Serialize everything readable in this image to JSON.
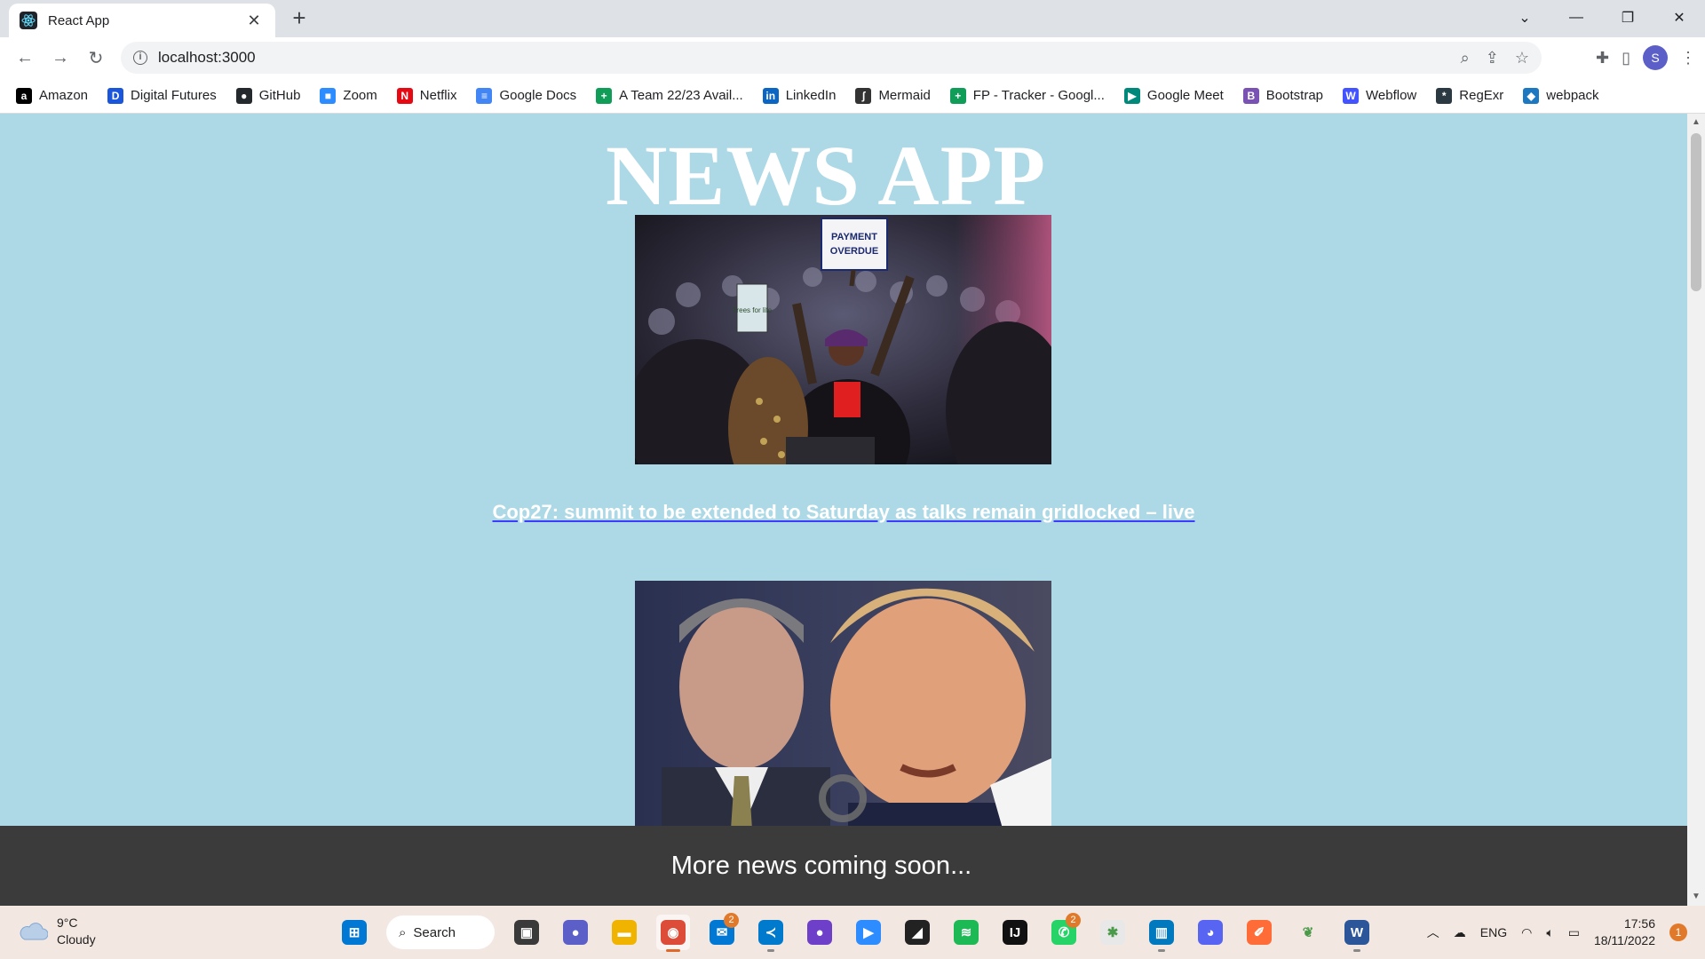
{
  "browser": {
    "tab_title": "React App",
    "url": "localhost:3000",
    "profile_initial": "S"
  },
  "bookmarks": [
    {
      "label": "Amazon",
      "icon": "amazon-icon",
      "color": "#000000",
      "glyph": "a"
    },
    {
      "label": "Digital Futures",
      "icon": "digital-futures-icon",
      "color": "#1a56db",
      "glyph": "D"
    },
    {
      "label": "GitHub",
      "icon": "github-icon",
      "color": "#24292e",
      "glyph": "●"
    },
    {
      "label": "Zoom",
      "icon": "zoom-icon",
      "color": "#2d8cff",
      "glyph": "■"
    },
    {
      "label": "Netflix",
      "icon": "netflix-icon",
      "color": "#e50914",
      "glyph": "N"
    },
    {
      "label": "Google Docs",
      "icon": "google-docs-icon",
      "color": "#4285f4",
      "glyph": "≡"
    },
    {
      "label": "A Team 22/23 Avail...",
      "icon": "google-sheets-icon",
      "color": "#0f9d58",
      "glyph": "+"
    },
    {
      "label": "LinkedIn",
      "icon": "linkedin-icon",
      "color": "#0a66c2",
      "glyph": "in"
    },
    {
      "label": "Mermaid",
      "icon": "mermaid-icon",
      "color": "#333333",
      "glyph": "ʃ"
    },
    {
      "label": "FP - Tracker - Googl...",
      "icon": "google-sheets-icon",
      "color": "#0f9d58",
      "glyph": "+"
    },
    {
      "label": "Google Meet",
      "icon": "google-meet-icon",
      "color": "#00897b",
      "glyph": "▶"
    },
    {
      "label": "Bootstrap",
      "icon": "bootstrap-icon",
      "color": "#7952b3",
      "glyph": "B"
    },
    {
      "label": "Webflow",
      "icon": "webflow-icon",
      "color": "#4353ff",
      "glyph": "W"
    },
    {
      "label": "RegExr",
      "icon": "regexr-icon",
      "color": "#2b3a42",
      "glyph": "*"
    },
    {
      "label": "webpack",
      "icon": "webpack-icon",
      "color": "#1c78c0",
      "glyph": "◆"
    }
  ],
  "app": {
    "title": "NEWS APP",
    "articles": [
      {
        "headline": "Cop27: summit to be extended to Saturday as talks remain gridlocked – live",
        "image_alt": "Protesters at COP27 holding a PAYMENT OVERDUE sign",
        "sign_text": "PAYMENT OVERDUE",
        "sign_sub": "Trees for life"
      },
      {
        "headline": "",
        "image_alt": "Two men at a press briefing"
      }
    ],
    "footer": "More news coming soon..."
  },
  "taskbar": {
    "weather_temp": "9°C",
    "weather_desc": "Cloudy",
    "search_label": "Search",
    "apps": [
      {
        "name": "windows-start",
        "color": "#0078d4",
        "glyph": "⊞"
      },
      {
        "name": "task-view",
        "color": "#3a3a3a",
        "glyph": "▣"
      },
      {
        "name": "teams-chat",
        "color": "#5b5fc7",
        "glyph": "●"
      },
      {
        "name": "file-explorer",
        "color": "#f0b400",
        "glyph": "▬"
      },
      {
        "name": "chrome",
        "color": "#dd4b39",
        "glyph": "◉",
        "active": true
      },
      {
        "name": "mail",
        "color": "#0078d4",
        "glyph": "✉",
        "badge": "2"
      },
      {
        "name": "vs-code",
        "color": "#007acc",
        "glyph": "≺"
      },
      {
        "name": "github-desktop",
        "color": "#6e40c9",
        "glyph": "●"
      },
      {
        "name": "zoom",
        "color": "#2d8cff",
        "glyph": "▶"
      },
      {
        "name": "sticky-notes",
        "color": "#222222",
        "glyph": "◢"
      },
      {
        "name": "spotify",
        "color": "#1db954",
        "glyph": "≋"
      },
      {
        "name": "intellij",
        "color": "#111111",
        "glyph": "IJ"
      },
      {
        "name": "whatsapp",
        "color": "#25d366",
        "glyph": "✆",
        "badge": "2"
      },
      {
        "name": "slack",
        "color": "#e8e8e8",
        "glyph": "✱"
      },
      {
        "name": "trello",
        "color": "#0079bf",
        "glyph": "▥"
      },
      {
        "name": "discord",
        "color": "#5865f2",
        "glyph": "◕"
      },
      {
        "name": "postman",
        "color": "#ff6c37",
        "glyph": "✐"
      },
      {
        "name": "mongodb",
        "color": "#f3e7e1",
        "glyph": "❦"
      },
      {
        "name": "word",
        "color": "#2b579a",
        "glyph": "W"
      }
    ],
    "language": "ENG",
    "time": "17:56",
    "date": "18/11/2022",
    "notification_count": "1"
  }
}
